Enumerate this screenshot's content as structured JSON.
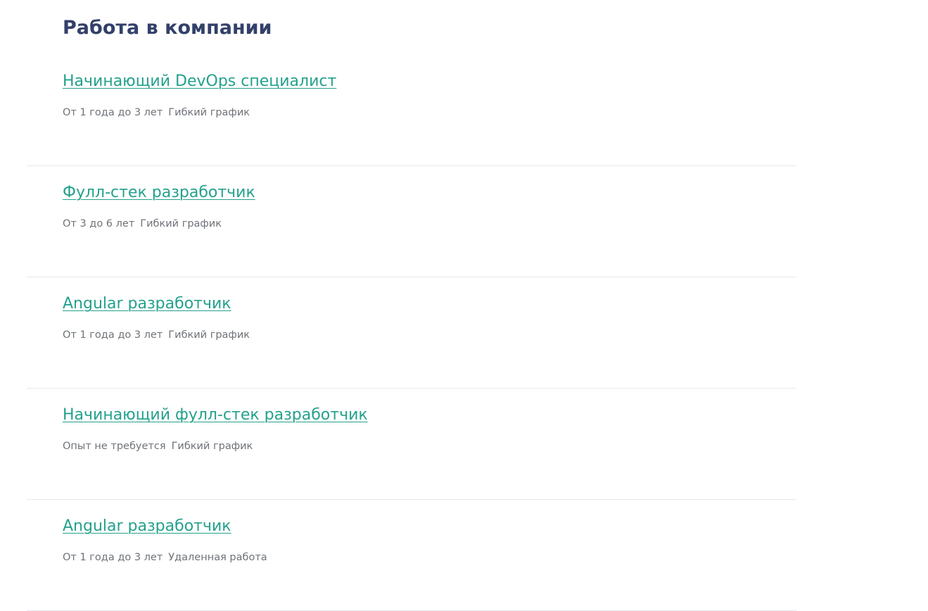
{
  "page": {
    "title": "Работа в компании"
  },
  "vacancies": [
    {
      "title": "Начинающий DevOps специалист",
      "experience": "От 1 года до 3 лет",
      "schedule": "Гибкий график"
    },
    {
      "title": "Фулл-стек разработчик",
      "experience": "От 3 до 6 лет",
      "schedule": "Гибкий график"
    },
    {
      "title": "Angular разработчик",
      "experience": "От 1 года до 3 лет",
      "schedule": "Гибкий график"
    },
    {
      "title": "Начинающий фулл-стек разработчик",
      "experience": "Опыт не требуется",
      "schedule": "Гибкий график"
    },
    {
      "title": "Angular разработчик",
      "experience": "От 1 года до 3 лет",
      "schedule": "Удаленная работа"
    }
  ],
  "colors": {
    "title": "#33406a",
    "link": "#24a18c",
    "meta": "#6e7378",
    "divider": "#e5e8ec"
  }
}
